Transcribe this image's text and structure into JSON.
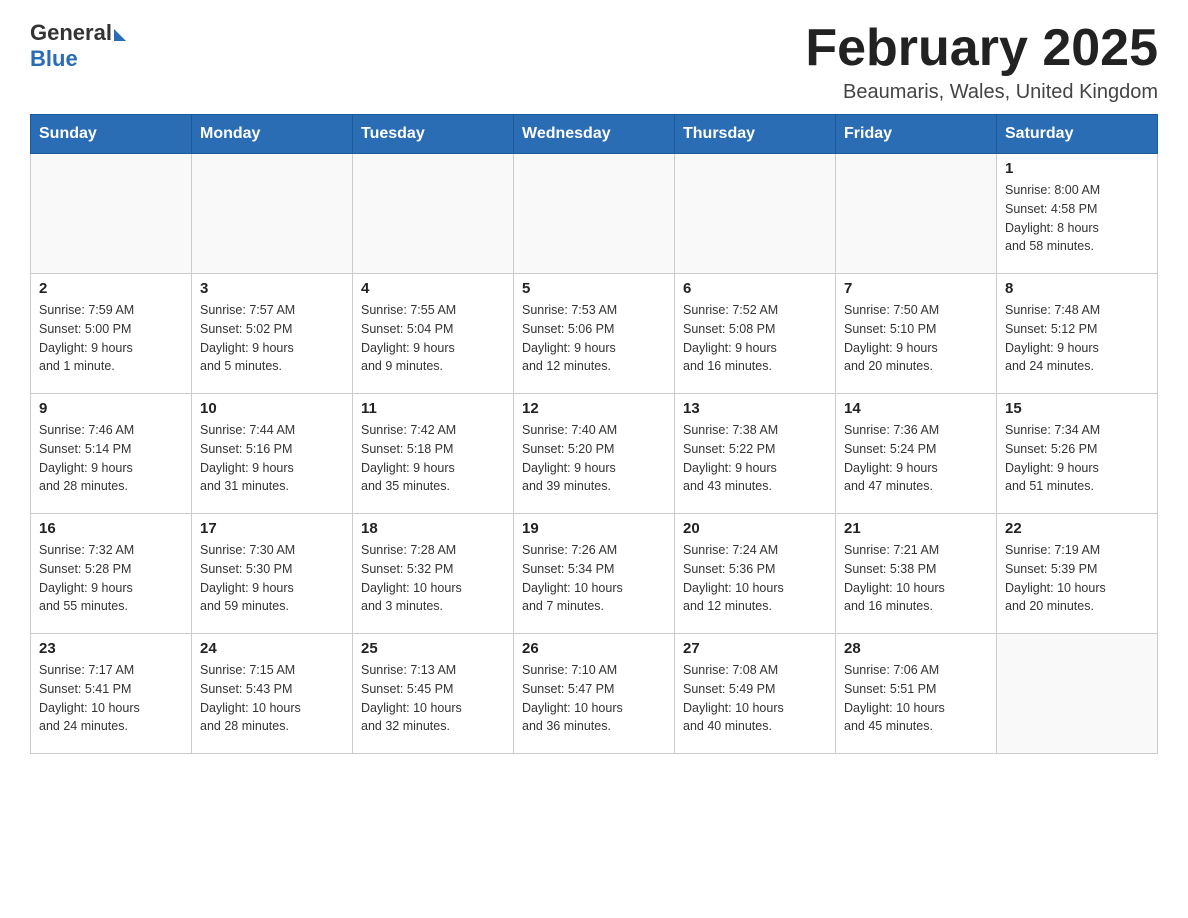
{
  "header": {
    "logo_general": "General",
    "logo_blue": "Blue",
    "title": "February 2025",
    "subtitle": "Beaumaris, Wales, United Kingdom"
  },
  "weekdays": [
    "Sunday",
    "Monday",
    "Tuesday",
    "Wednesday",
    "Thursday",
    "Friday",
    "Saturday"
  ],
  "weeks": [
    [
      {
        "day": "",
        "info": ""
      },
      {
        "day": "",
        "info": ""
      },
      {
        "day": "",
        "info": ""
      },
      {
        "day": "",
        "info": ""
      },
      {
        "day": "",
        "info": ""
      },
      {
        "day": "",
        "info": ""
      },
      {
        "day": "1",
        "info": "Sunrise: 8:00 AM\nSunset: 4:58 PM\nDaylight: 8 hours\nand 58 minutes."
      }
    ],
    [
      {
        "day": "2",
        "info": "Sunrise: 7:59 AM\nSunset: 5:00 PM\nDaylight: 9 hours\nand 1 minute."
      },
      {
        "day": "3",
        "info": "Sunrise: 7:57 AM\nSunset: 5:02 PM\nDaylight: 9 hours\nand 5 minutes."
      },
      {
        "day": "4",
        "info": "Sunrise: 7:55 AM\nSunset: 5:04 PM\nDaylight: 9 hours\nand 9 minutes."
      },
      {
        "day": "5",
        "info": "Sunrise: 7:53 AM\nSunset: 5:06 PM\nDaylight: 9 hours\nand 12 minutes."
      },
      {
        "day": "6",
        "info": "Sunrise: 7:52 AM\nSunset: 5:08 PM\nDaylight: 9 hours\nand 16 minutes."
      },
      {
        "day": "7",
        "info": "Sunrise: 7:50 AM\nSunset: 5:10 PM\nDaylight: 9 hours\nand 20 minutes."
      },
      {
        "day": "8",
        "info": "Sunrise: 7:48 AM\nSunset: 5:12 PM\nDaylight: 9 hours\nand 24 minutes."
      }
    ],
    [
      {
        "day": "9",
        "info": "Sunrise: 7:46 AM\nSunset: 5:14 PM\nDaylight: 9 hours\nand 28 minutes."
      },
      {
        "day": "10",
        "info": "Sunrise: 7:44 AM\nSunset: 5:16 PM\nDaylight: 9 hours\nand 31 minutes."
      },
      {
        "day": "11",
        "info": "Sunrise: 7:42 AM\nSunset: 5:18 PM\nDaylight: 9 hours\nand 35 minutes."
      },
      {
        "day": "12",
        "info": "Sunrise: 7:40 AM\nSunset: 5:20 PM\nDaylight: 9 hours\nand 39 minutes."
      },
      {
        "day": "13",
        "info": "Sunrise: 7:38 AM\nSunset: 5:22 PM\nDaylight: 9 hours\nand 43 minutes."
      },
      {
        "day": "14",
        "info": "Sunrise: 7:36 AM\nSunset: 5:24 PM\nDaylight: 9 hours\nand 47 minutes."
      },
      {
        "day": "15",
        "info": "Sunrise: 7:34 AM\nSunset: 5:26 PM\nDaylight: 9 hours\nand 51 minutes."
      }
    ],
    [
      {
        "day": "16",
        "info": "Sunrise: 7:32 AM\nSunset: 5:28 PM\nDaylight: 9 hours\nand 55 minutes."
      },
      {
        "day": "17",
        "info": "Sunrise: 7:30 AM\nSunset: 5:30 PM\nDaylight: 9 hours\nand 59 minutes."
      },
      {
        "day": "18",
        "info": "Sunrise: 7:28 AM\nSunset: 5:32 PM\nDaylight: 10 hours\nand 3 minutes."
      },
      {
        "day": "19",
        "info": "Sunrise: 7:26 AM\nSunset: 5:34 PM\nDaylight: 10 hours\nand 7 minutes."
      },
      {
        "day": "20",
        "info": "Sunrise: 7:24 AM\nSunset: 5:36 PM\nDaylight: 10 hours\nand 12 minutes."
      },
      {
        "day": "21",
        "info": "Sunrise: 7:21 AM\nSunset: 5:38 PM\nDaylight: 10 hours\nand 16 minutes."
      },
      {
        "day": "22",
        "info": "Sunrise: 7:19 AM\nSunset: 5:39 PM\nDaylight: 10 hours\nand 20 minutes."
      }
    ],
    [
      {
        "day": "23",
        "info": "Sunrise: 7:17 AM\nSunset: 5:41 PM\nDaylight: 10 hours\nand 24 minutes."
      },
      {
        "day": "24",
        "info": "Sunrise: 7:15 AM\nSunset: 5:43 PM\nDaylight: 10 hours\nand 28 minutes."
      },
      {
        "day": "25",
        "info": "Sunrise: 7:13 AM\nSunset: 5:45 PM\nDaylight: 10 hours\nand 32 minutes."
      },
      {
        "day": "26",
        "info": "Sunrise: 7:10 AM\nSunset: 5:47 PM\nDaylight: 10 hours\nand 36 minutes."
      },
      {
        "day": "27",
        "info": "Sunrise: 7:08 AM\nSunset: 5:49 PM\nDaylight: 10 hours\nand 40 minutes."
      },
      {
        "day": "28",
        "info": "Sunrise: 7:06 AM\nSunset: 5:51 PM\nDaylight: 10 hours\nand 45 minutes."
      },
      {
        "day": "",
        "info": ""
      }
    ]
  ]
}
